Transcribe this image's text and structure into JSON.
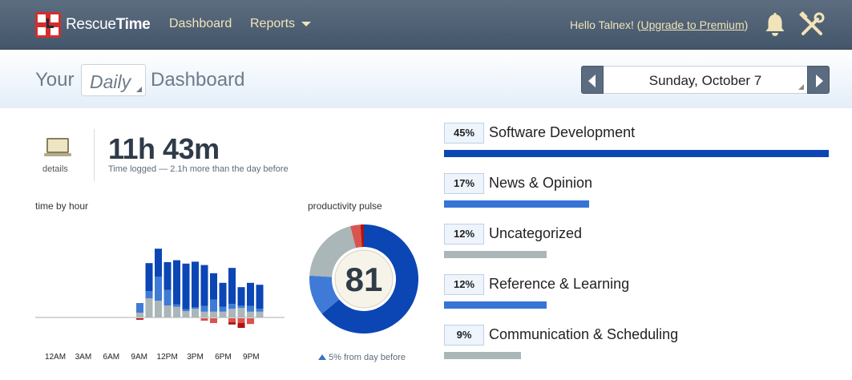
{
  "app": {
    "brand_light": "Rescue",
    "brand_bold": "Time"
  },
  "nav": {
    "dashboard": "Dashboard",
    "reports": "Reports",
    "greeting_prefix": "Hello Talnex! (",
    "upgrade_link": "Upgrade to Premium",
    "greeting_suffix": ")",
    "bell_icon": "bell-icon",
    "tools_icon": "tools-icon"
  },
  "header": {
    "your": "Your",
    "period": "Daily",
    "dashboard": "Dashboard",
    "date": "Sunday, October 7"
  },
  "summary": {
    "details_label": "details",
    "time_logged": "11h 43m",
    "time_sub": "Time logged — 2.1h more than the day before"
  },
  "labels": {
    "time_by_hour": "time by hour",
    "productivity_pulse": "productivity pulse",
    "pulse_change": "5% from day before"
  },
  "colors": {
    "very_productive": "#0b46b4",
    "productive": "#3f7bd6",
    "neutral": "#aab6b7",
    "distracting": "#d9534f",
    "very_distracting": "#b1130f",
    "axis": "#c8c8c8"
  },
  "chart_data": [
    {
      "type": "bar",
      "stacked": true,
      "xlabel": "",
      "ylabel": "",
      "categories": [
        "9AM",
        "10AM",
        "11AM",
        "12PM",
        "1PM",
        "2PM",
        "3PM",
        "4PM",
        "5PM",
        "6PM",
        "7PM",
        "8PM",
        "9PM",
        "10PM"
      ],
      "tick_labels": [
        "12AM",
        "3AM",
        "6AM",
        "9AM",
        "12PM",
        "3PM",
        "6PM",
        "9PM"
      ],
      "series": [
        {
          "key": "very_productive",
          "values": [
            0.0,
            0.58,
            0.58,
            0.58,
            0.92,
            0.95,
            0.95,
            0.85,
            0.55,
            0.5,
            0.75,
            0.38,
            0.48,
            0.5
          ]
        },
        {
          "key": "productive",
          "values": [
            0.2,
            0.15,
            0.5,
            0.32,
            0.05,
            0.04,
            0.03,
            0.12,
            0.25,
            0.1,
            0.1,
            0.05,
            0.12,
            0.06
          ]
        },
        {
          "key": "neutral",
          "values": [
            0.1,
            0.4,
            0.35,
            0.25,
            0.22,
            0.13,
            0.18,
            0.12,
            0.12,
            0.12,
            0.18,
            0.2,
            0.12,
            0.12
          ]
        },
        {
          "key": "distracting",
          "values": [
            0.0,
            0.0,
            0.0,
            0.0,
            0.0,
            0.0,
            0.0,
            0.05,
            0.1,
            0.0,
            0.08,
            0.1,
            0.12,
            0.0
          ]
        },
        {
          "key": "very_distracting",
          "values": [
            0.03,
            0.0,
            0.0,
            0.0,
            0.0,
            0.0,
            0.0,
            0.0,
            0.0,
            0.0,
            0.05,
            0.1,
            0.0,
            0.0
          ]
        }
      ]
    },
    {
      "type": "pie",
      "donut": true,
      "center_label": "81",
      "slices": [
        {
          "key": "very_productive",
          "value": 64
        },
        {
          "key": "productive",
          "value": 12
        },
        {
          "key": "neutral",
          "value": 20
        },
        {
          "key": "distracting",
          "value": 3
        },
        {
          "key": "very_distracting",
          "value": 1
        }
      ]
    }
  ],
  "categories": [
    {
      "percent": "45%",
      "name": "Software Development",
      "fraction": 0.45,
      "color": "#0b46b4"
    },
    {
      "percent": "17%",
      "name": "News & Opinion",
      "fraction": 0.17,
      "color": "#3674d6"
    },
    {
      "percent": "12%",
      "name": "Uncategorized",
      "fraction": 0.12,
      "color": "#aab6b7"
    },
    {
      "percent": "12%",
      "name": "Reference & Learning",
      "fraction": 0.12,
      "color": "#3674d6"
    },
    {
      "percent": "9%",
      "name": "Communication & Scheduling",
      "fraction": 0.09,
      "color": "#aab6b7"
    }
  ]
}
